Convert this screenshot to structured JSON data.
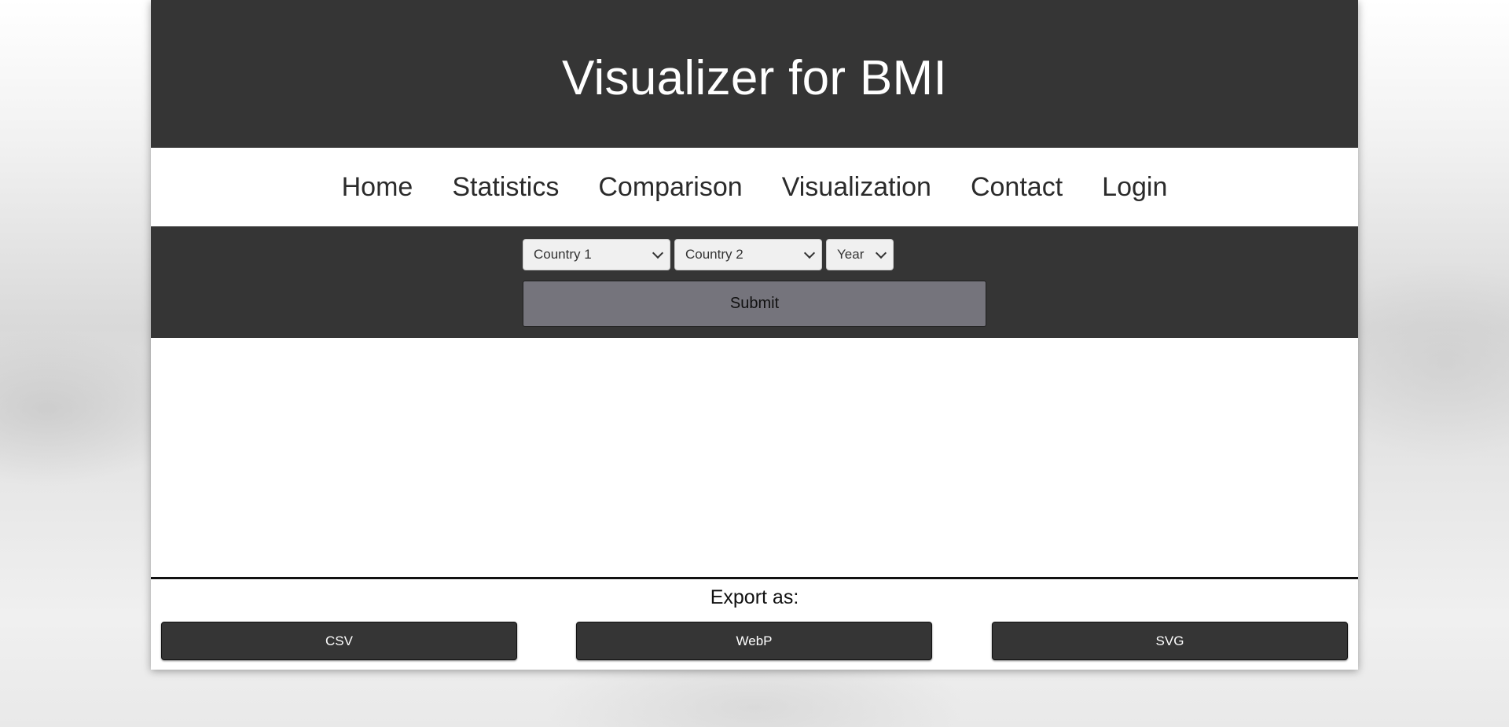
{
  "header": {
    "title": "Visualizer for BMI"
  },
  "nav": {
    "items": [
      {
        "label": "Home"
      },
      {
        "label": "Statistics"
      },
      {
        "label": "Comparison"
      },
      {
        "label": "Visualization"
      },
      {
        "label": "Contact"
      },
      {
        "label": "Login"
      }
    ]
  },
  "form": {
    "country1": "Country 1",
    "country2": "Country 2",
    "year": "Year",
    "submit_label": "Submit"
  },
  "export": {
    "title": "Export as:",
    "buttons": [
      {
        "label": "CSV"
      },
      {
        "label": "WebP"
      },
      {
        "label": "SVG"
      }
    ]
  },
  "colors": {
    "dark": "#353535",
    "submit": "#75747c",
    "page": "#ffffff"
  }
}
